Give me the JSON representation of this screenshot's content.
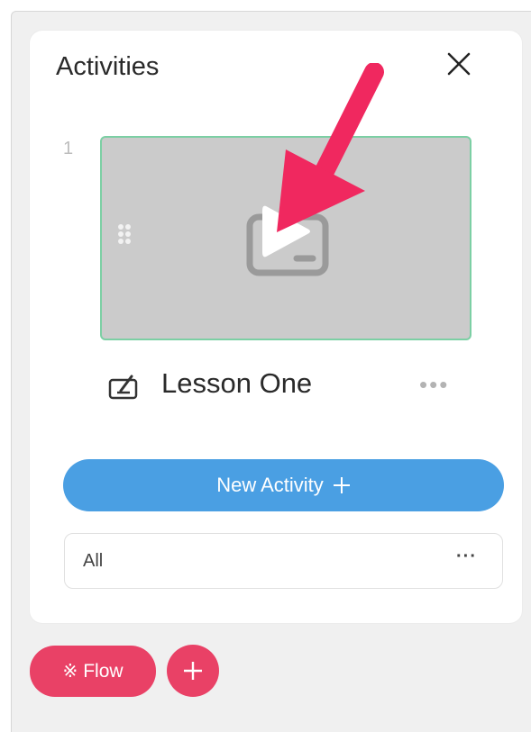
{
  "panel": {
    "title": "Activities",
    "close_icon": "close-icon"
  },
  "activities": [
    {
      "number": "1",
      "title": "Lesson One",
      "type_icon": "slideshow-edit-icon",
      "thumbnail_icon": "presentation-icon",
      "more_label": "•••"
    }
  ],
  "new_activity": {
    "label": "New Activity"
  },
  "filter": {
    "label": "All",
    "more_label": "···"
  },
  "bottom": {
    "flow_label": "Flow",
    "flow_icon": "※"
  },
  "colors": {
    "primary_blue": "#4a9fe3",
    "accent_pink": "#e94166",
    "thumb_border": "#7ccfa4",
    "arrow": "#f0285f"
  }
}
